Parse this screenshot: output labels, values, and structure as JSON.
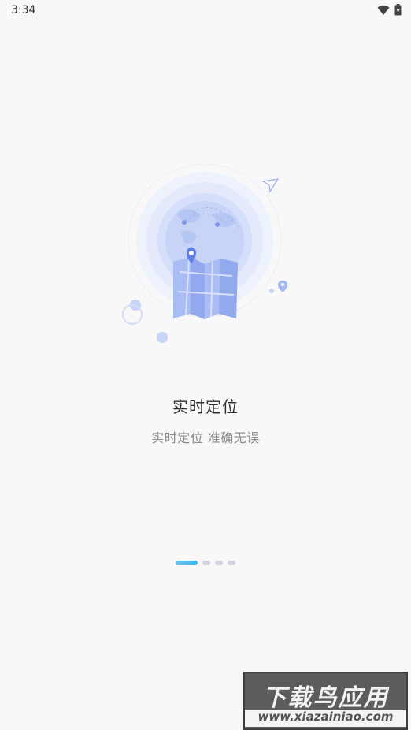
{
  "status": {
    "time": "3:34",
    "wifi_icon": "wifi-icon",
    "battery_icon": "battery-charging-icon"
  },
  "onboarding": {
    "title": "实时定位",
    "subtitle": "实时定位 准确无误",
    "page_count": 4,
    "active_page": 1,
    "illustration": "globe-with-map-icon"
  },
  "watermark": {
    "top": "下载鸟应用",
    "bottom": "www.xiazainiao.com"
  }
}
